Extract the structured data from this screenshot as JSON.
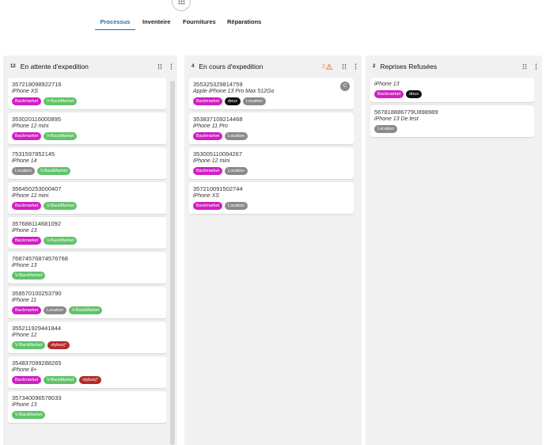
{
  "icons": {
    "apps": "apps-grid-icon",
    "drag": "drag-handle-icon",
    "more": "more-vert-icon",
    "warning": "warning-icon",
    "avatar": "avatar"
  },
  "colors": {
    "accent": "#1f6fb2",
    "tag": {
      "Backmarket": "#d11fc4",
      "V-BackMarket": "#62c36a",
      "Location": "#8a8a8a",
      "deux": "#111111",
      "vtybunj°": "#b22b2b"
    }
  },
  "tabs": [
    {
      "label": "Processus",
      "active": true
    },
    {
      "label": "Inventeire",
      "active": false
    },
    {
      "label": "Fournitures",
      "active": false
    },
    {
      "label": "Réparations",
      "active": false
    }
  ],
  "columns": [
    {
      "count": "12",
      "title": "En attente d'expedition",
      "warning": "",
      "cards": [
        {
          "code": "357218098922716",
          "model": "iPhone XS",
          "tags": [
            "Backmarket",
            "V-BackMarket"
          ]
        },
        {
          "code": "353020116000895",
          "model": "iPhone 12 mini",
          "tags": [
            "Backmarket",
            "V-BackMarket"
          ]
        },
        {
          "code": "7531597852145",
          "model": "iPhone 14",
          "tags": [
            "Location",
            "V-BackMarket"
          ]
        },
        {
          "code": "356450253000407",
          "model": "iPhone 12 mini",
          "tags": [
            "Backmarket",
            "V-BackMarket"
          ]
        },
        {
          "code": "357688114681092",
          "model": "iPhone 13",
          "tags": [
            "Backmarket",
            "V-BackMarket"
          ]
        },
        {
          "code": "76874576874576768",
          "model": "iPhone 13",
          "tags": [
            "V-BackMarket"
          ]
        },
        {
          "code": "358570100253790",
          "model": "iPhone 11",
          "tags": [
            "Backmarket",
            "Location",
            "V-BackMarket"
          ]
        },
        {
          "code": "355211929441844",
          "model": "iPhone 12",
          "tags": [
            "V-BackMarket",
            "vtybunj°"
          ]
        },
        {
          "code": "354837099288265",
          "model": "iPhone 8+",
          "tags": [
            "Backmarket",
            "V-BackMarket",
            "vtybunj°"
          ]
        },
        {
          "code": "357340096578033",
          "model": "iPhone 13",
          "tags": [
            "V-BackMarket"
          ]
        }
      ]
    },
    {
      "count": "4",
      "title": "En cours d'expedition",
      "warning": "2",
      "cards": [
        {
          "code": "355325329814759",
          "model": "Apple iPhone 13 Pro Max 512Go",
          "tags": [
            "Backmarket",
            "deux",
            "Location"
          ],
          "avatar": "C"
        },
        {
          "code": "353837109214468",
          "model": "iPhone 11 Pro",
          "tags": [
            "Backmarket",
            "Location"
          ]
        },
        {
          "code": "353005110094267",
          "model": "iPhone 12 mini",
          "tags": [
            "Backmarket",
            "Location"
          ]
        },
        {
          "code": "357210091502744",
          "model": "iPhone XS",
          "tags": [
            "Backmarket",
            "Location"
          ]
        }
      ]
    },
    {
      "count": "2",
      "title": "Reprises Refusées",
      "warning": "",
      "cards": [
        {
          "code": "",
          "model": "iPhone 13",
          "tags": [
            "Backmarket",
            "deux"
          ]
        },
        {
          "code": "567818886779U898989",
          "model": "iPhone 13 De test",
          "tags": [
            "Location"
          ]
        }
      ]
    }
  ]
}
